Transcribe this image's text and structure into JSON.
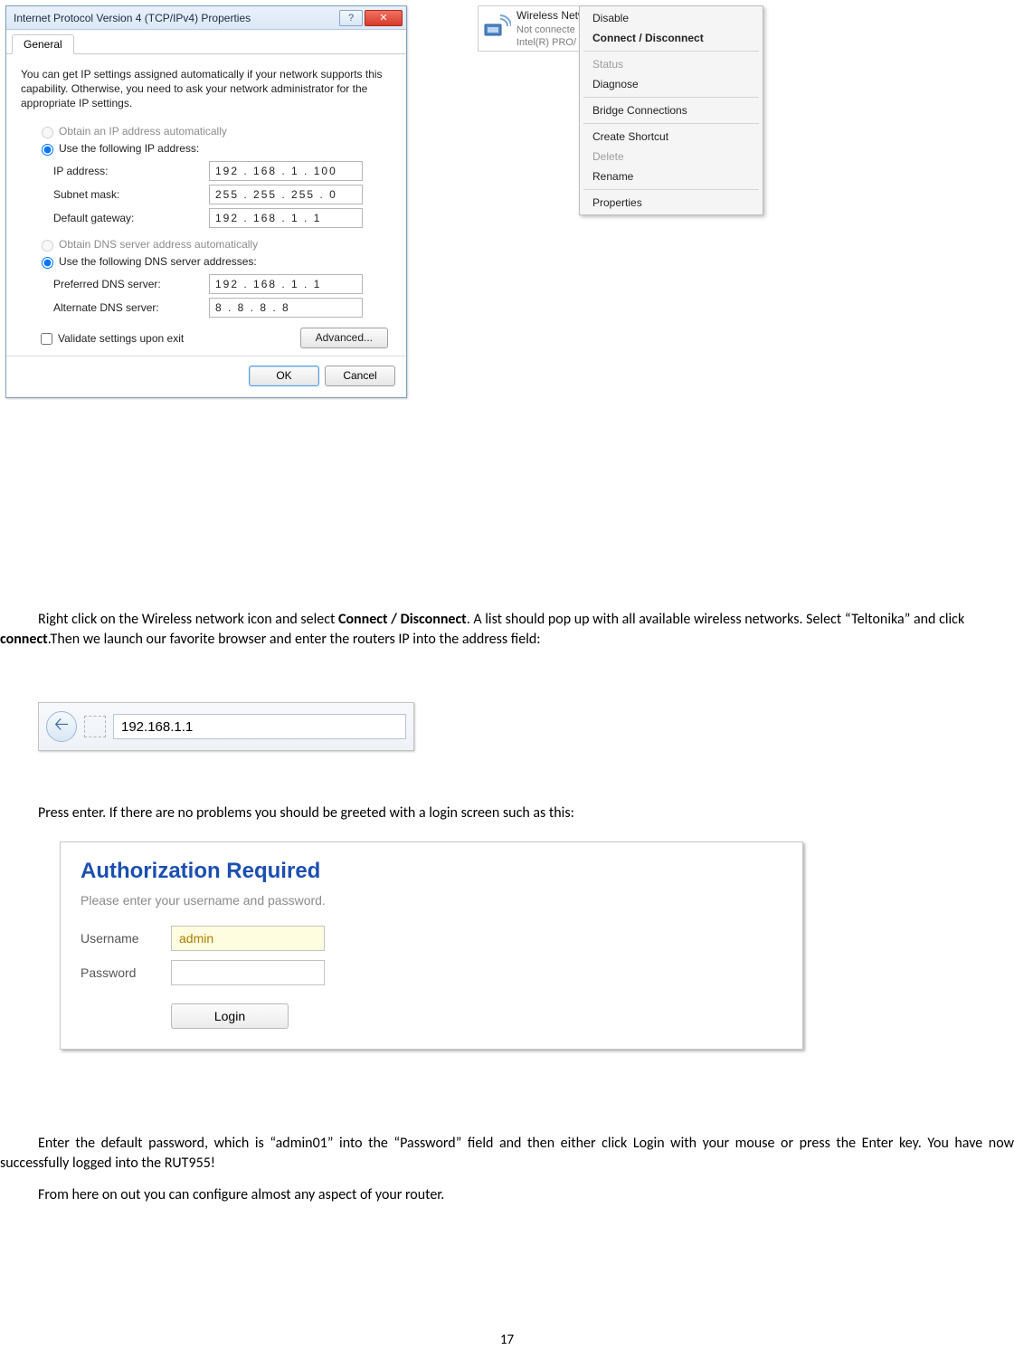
{
  "ipv4_dialog": {
    "title": "Internet Protocol Version 4 (TCP/IPv4) Properties",
    "tab": "General",
    "intro": "You can get IP settings assigned automatically if your network supports this capability. Otherwise, you need to ask your network administrator for the appropriate IP settings.",
    "radio_auto_ip": "Obtain an IP address automatically",
    "radio_use_ip": "Use the following IP address:",
    "ip_label": "IP address:",
    "ip_value": "192 . 168 .  1   . 100",
    "mask_label": "Subnet mask:",
    "mask_value": "255 . 255 . 255 .  0",
    "gw_label": "Default gateway:",
    "gw_value": "192 . 168 .  1   .  1",
    "radio_auto_dns": "Obtain DNS server address automatically",
    "radio_use_dns": "Use the following DNS server addresses:",
    "pref_dns_label": "Preferred DNS server:",
    "pref_dns_value": "192 . 168 .  1   .  1",
    "alt_dns_label": "Alternate DNS server:",
    "alt_dns_value": " 8  .  8  .  8  .  8",
    "validate": "Validate settings upon exit",
    "advanced": "Advanced...",
    "ok": "OK",
    "cancel": "Cancel"
  },
  "net_header": {
    "line1": "Wireless Network Connection",
    "line2": "Not connecte",
    "line3": "Intel(R) PRO/"
  },
  "ctx": {
    "disable": "Disable",
    "connect": "Connect / Disconnect",
    "status": "Status",
    "diagnose": "Diagnose",
    "bridge": "Bridge Connections",
    "shortcut": "Create Shortcut",
    "delete": "Delete",
    "rename": "Rename",
    "properties": "Properties"
  },
  "para1_a": "Right click on the Wireless network icon and select ",
  "para1_b": "Connect / Disconnect",
  "para1_c": ". A list should pop up with all available wireless networks. Select “Teltonika” and click ",
  "para1_d": "connect",
  "para1_e": ".Then we launch our favorite browser and enter the routers IP into the address field:",
  "addr_value": "192.168.1.1",
  "para2": "Press enter. If there are no problems you should be greeted with a login screen such as this:",
  "login": {
    "heading": "Authorization Required",
    "sub": "Please enter your username and password.",
    "user_label": "Username",
    "user_value": "admin",
    "pass_label": "Password",
    "login_btn": "Login"
  },
  "para3": "Enter the default password, which is “admin01” into the “Password” field and then either click Login with your mouse or press the Enter key. You have now successfully logged into the RUT955!",
  "para4": "From here on out you can configure almost any aspect of your router.",
  "page_number": "17"
}
